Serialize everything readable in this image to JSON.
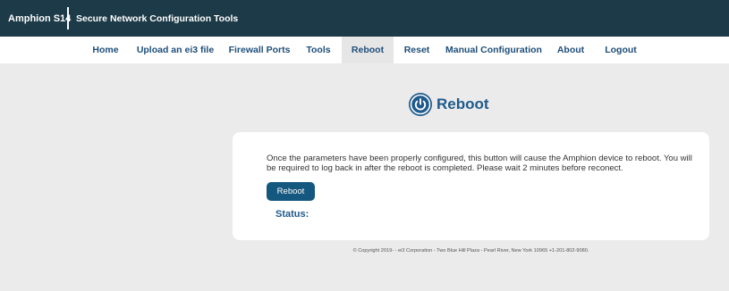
{
  "header": {
    "brand": "Amphion S14",
    "subtitle": "Secure Network Configuration Tools"
  },
  "nav": {
    "items": [
      {
        "label": "Home",
        "active": false
      },
      {
        "label": "Upload an ei3 file",
        "active": false
      },
      {
        "label": "Firewall Ports",
        "active": false
      },
      {
        "label": "Tools",
        "active": false
      },
      {
        "label": "Reboot",
        "active": true
      },
      {
        "label": "Reset",
        "active": false
      },
      {
        "label": "Manual Configuration",
        "active": false
      },
      {
        "label": "About",
        "active": false
      },
      {
        "label": "Logout",
        "active": false
      }
    ]
  },
  "page": {
    "title": "Reboot",
    "icon": "power-icon",
    "description": "Once the parameters have been properly configured, this button will cause the Amphion device to reboot. You will be required to log back in after the reboot is completed. Please wait 2 minutes before reconect.",
    "button_label": "Reboot",
    "status_label": "Status:"
  },
  "footer": {
    "copyright": "© Copyright 2019- - ei3 Corporation - Two Blue Hill Plaza - Pearl River, New York 10965 +1-201-802-9080."
  },
  "colors": {
    "header_bg": "#1d3a48",
    "accent": "#1e5a8a",
    "button_bg": "#14577f",
    "page_bg": "#ebebeb"
  }
}
